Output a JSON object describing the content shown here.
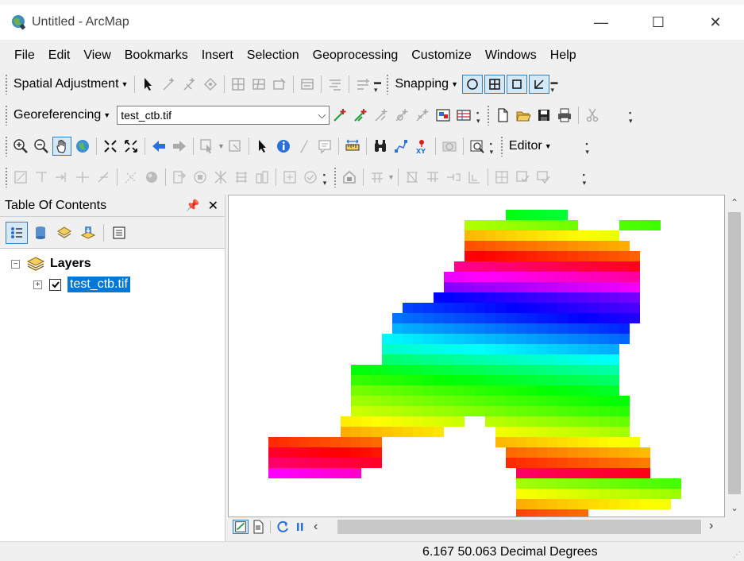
{
  "window": {
    "title": "Untitled - ArcMap",
    "controls": {
      "minimize": "—",
      "maximize": "☐",
      "close": "✕"
    }
  },
  "menubar": {
    "items": [
      {
        "label": "File"
      },
      {
        "label": "Edit"
      },
      {
        "label": "View"
      },
      {
        "label": "Bookmarks"
      },
      {
        "label": "Insert"
      },
      {
        "label": "Selection"
      },
      {
        "label": "Geoprocessing"
      },
      {
        "label": "Customize"
      },
      {
        "label": "Windows"
      },
      {
        "label": "Help"
      }
    ]
  },
  "toolbars": {
    "spatial_adjustment_label": "Spatial Adjustment",
    "snapping_label": "Snapping",
    "georeferencing_label": "Georeferencing",
    "georef_layer_value": "test_ctb.tif",
    "editor_label": "Editor"
  },
  "toc": {
    "title": "Table Of Contents",
    "pin": "➕",
    "close": "✕",
    "group_label": "Layers",
    "layer_label": "test_ctb.tif"
  },
  "status": {
    "coordinates": "6.167  50.063 Decimal Degrees"
  },
  "colors": {
    "selection": "#0078d7",
    "snapping_active": "#d5e8f7"
  }
}
